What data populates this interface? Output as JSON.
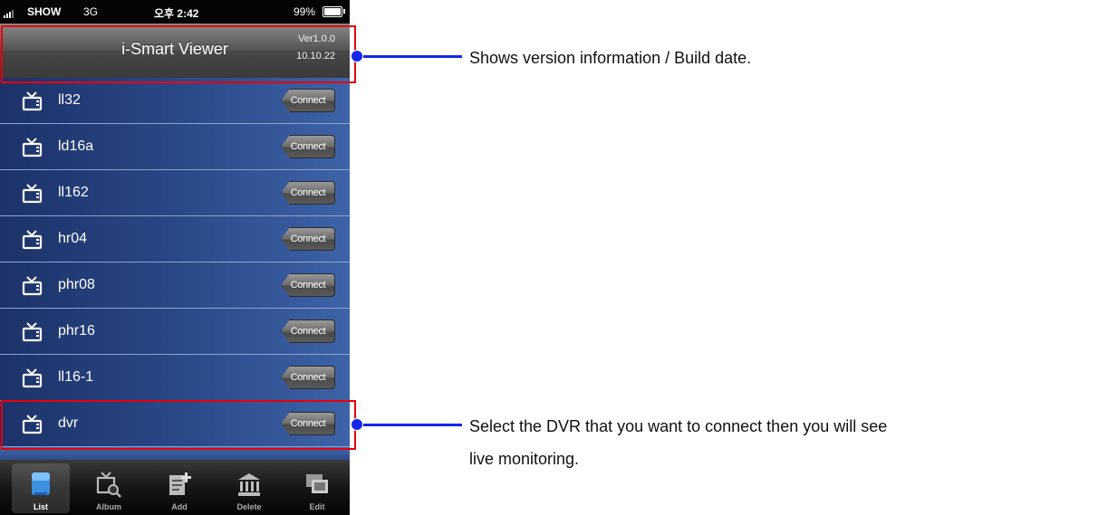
{
  "status_bar": {
    "carrier": "SHOW",
    "network": "3G",
    "time": "오후 2:42",
    "battery": "99%"
  },
  "header": {
    "title": "i-Smart Viewer",
    "version": "Ver1.0.0",
    "build_date": "10.10.22"
  },
  "dvr_list": {
    "connect_label": "Connect",
    "items": [
      "ll32",
      "ld16a",
      "ll162",
      "hr04",
      "phr08",
      "phr16",
      "ll16-1",
      "dvr"
    ]
  },
  "tab_bar": {
    "tabs": [
      {
        "label": "List",
        "icon": "list-icon",
        "active": true
      },
      {
        "label": "Album",
        "icon": "album-icon",
        "active": false
      },
      {
        "label": "Add",
        "icon": "add-icon",
        "active": false
      },
      {
        "label": "Delete",
        "icon": "delete-icon",
        "active": false
      },
      {
        "label": "Edit",
        "icon": "edit-icon",
        "active": false
      }
    ]
  },
  "annotations": {
    "version_note": "Shows version information / Build date.",
    "select_note_line1": "Select the DVR that you want to connect then you will see",
    "select_note_line2": "live monitoring."
  },
  "colors": {
    "highlight": "#e8000b",
    "leader": "#1526e8"
  }
}
